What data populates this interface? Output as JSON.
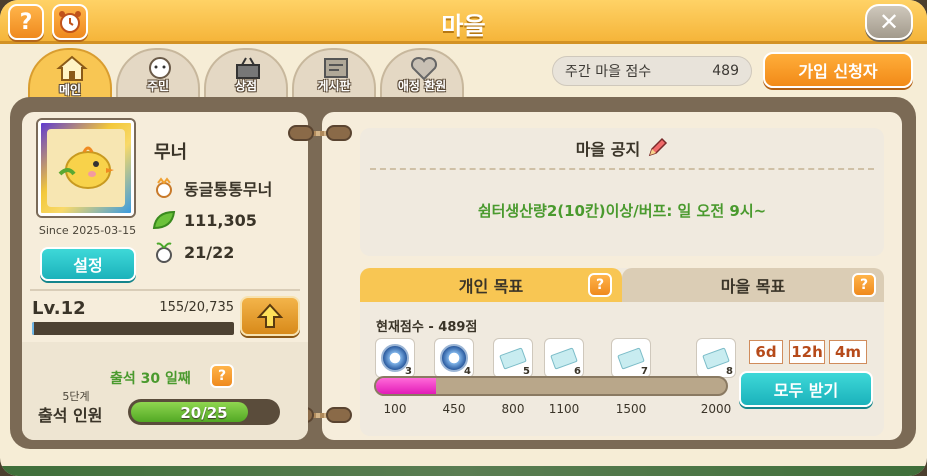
{
  "header": {
    "title": "마을",
    "help_icon": "question-icon",
    "alarm_icon": "alarm-clock-icon",
    "close_icon": "close-icon"
  },
  "tabs": [
    {
      "label": "메인",
      "icon": "house-icon",
      "active": true
    },
    {
      "label": "주민",
      "icon": "resident-icon",
      "active": false
    },
    {
      "label": "상점",
      "icon": "shop-basket-icon",
      "active": false
    },
    {
      "label": "게시판",
      "icon": "board-icon",
      "active": false
    },
    {
      "label": "애정 환원",
      "icon": "heart-icon",
      "active": false
    }
  ],
  "weekly": {
    "label": "주간 마을 점수",
    "value": "489"
  },
  "join_button": "가입 신청자",
  "profile": {
    "name": "무너",
    "since": "Since 2025-03-15",
    "settings": "설정",
    "village_name": "동글통통무너",
    "leaves": "111,305",
    "members": "21/22"
  },
  "level": {
    "label": "Lv.12",
    "exp": "155/20,735",
    "progress": 0.0075
  },
  "attendance": {
    "streak": "출석 30 일째",
    "stage": "5단계",
    "label": "출석 인원",
    "value": "20/25",
    "progress": 0.8
  },
  "notice": {
    "title": "마을 공지",
    "body": "쉼터생산량2(10칸)이상/버프: 일 오전 9시~"
  },
  "goals": {
    "tab_personal": "개인 목표",
    "tab_village": "마을 목표",
    "current": "현재점수 - 489점",
    "rewards": [
      {
        "num": "3",
        "type": "coin"
      },
      {
        "num": "4",
        "type": "coin"
      },
      {
        "num": "5",
        "type": "ticket"
      },
      {
        "num": "6",
        "type": "ticket"
      },
      {
        "num": "7",
        "type": "ticket"
      },
      {
        "num": "8",
        "type": "ticket"
      }
    ],
    "ticks": [
      "100",
      "450",
      "800",
      "1100",
      "1500",
      "2000"
    ],
    "progress": 0.172,
    "timer": {
      "d": "6d",
      "h": "12h",
      "m": "4m"
    },
    "claim_all": "모두 받기"
  }
}
